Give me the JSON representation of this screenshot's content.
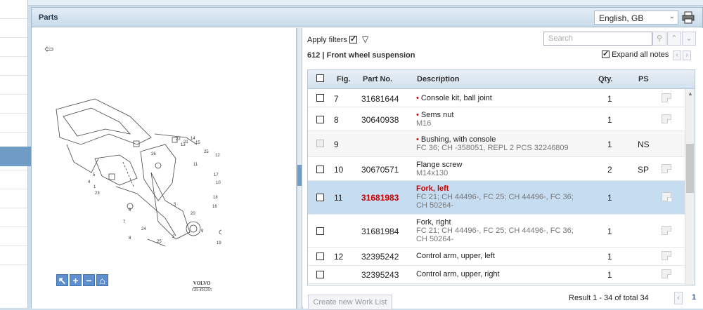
{
  "panel": {
    "title": "Parts",
    "language": "English, GB"
  },
  "filters": {
    "apply_label": "Apply filters",
    "search_placeholder": "Search"
  },
  "section": {
    "number": "612",
    "separator": "|",
    "name": "Front wheel suspension"
  },
  "expand_label": "Expand all notes",
  "columns": {
    "fig": "Fig.",
    "part_no": "Part No.",
    "description": "Description",
    "qty": "Qty.",
    "ps": "PS"
  },
  "rows": [
    {
      "fig": "7",
      "part": "31681644",
      "desc": "Console kit, ball joint",
      "sub": "",
      "qty": "1",
      "ps": "",
      "bullet": true
    },
    {
      "fig": "8",
      "part": "30640938",
      "desc": "Sems nut",
      "sub": "M16",
      "qty": "1",
      "ps": "",
      "bullet": true
    },
    {
      "fig": "9",
      "part": "",
      "desc": "Bushing, with console",
      "sub": "FC 36; CH -358051, REPL 2 PCS 32246809",
      "qty": "1",
      "ps": "NS",
      "bullet": true
    },
    {
      "fig": "10",
      "part": "30670571",
      "desc": "Flange screw",
      "sub": "M14x130",
      "qty": "2",
      "ps": "SP",
      "bullet": false
    },
    {
      "fig": "11",
      "part": "31681983",
      "desc": "Fork, left",
      "sub": "FC 21; CH 44496-, FC 25; CH 44496-, FC 36; CH 50264-",
      "qty": "1",
      "ps": "",
      "bullet": false
    },
    {
      "fig": "",
      "part": "31681984",
      "desc": "Fork, right",
      "sub": "FC 21; CH 44496-, FC 25; CH 44496-, FC 36; CH 50264-",
      "qty": "1",
      "ps": "",
      "bullet": false
    },
    {
      "fig": "12",
      "part": "32395242",
      "desc": "Control arm, upper, left",
      "sub": "",
      "qty": "1",
      "ps": "",
      "bullet": false
    },
    {
      "fig": "",
      "part": "32395243",
      "desc": "Control arm, upper, right",
      "sub": "",
      "qty": "1",
      "ps": "",
      "bullet": false
    }
  ],
  "footer": {
    "create_label": "Create new Work List",
    "result": "Result 1 - 34 of total 34",
    "page": "1"
  },
  "diagram": {
    "brand": "VOLVO",
    "code": "GB-456265",
    "callouts": [
      "2",
      "3",
      "4",
      "5",
      "6",
      "7",
      "8",
      "9",
      "10",
      "11",
      "12",
      "13",
      "14",
      "15",
      "16",
      "17",
      "18",
      "19",
      "20",
      "21",
      "22",
      "23",
      "24",
      "25",
      "26"
    ]
  },
  "colors": {
    "accent": "#6e9cc4",
    "highlight": "#c5dcf1",
    "red": "#cc0000"
  }
}
